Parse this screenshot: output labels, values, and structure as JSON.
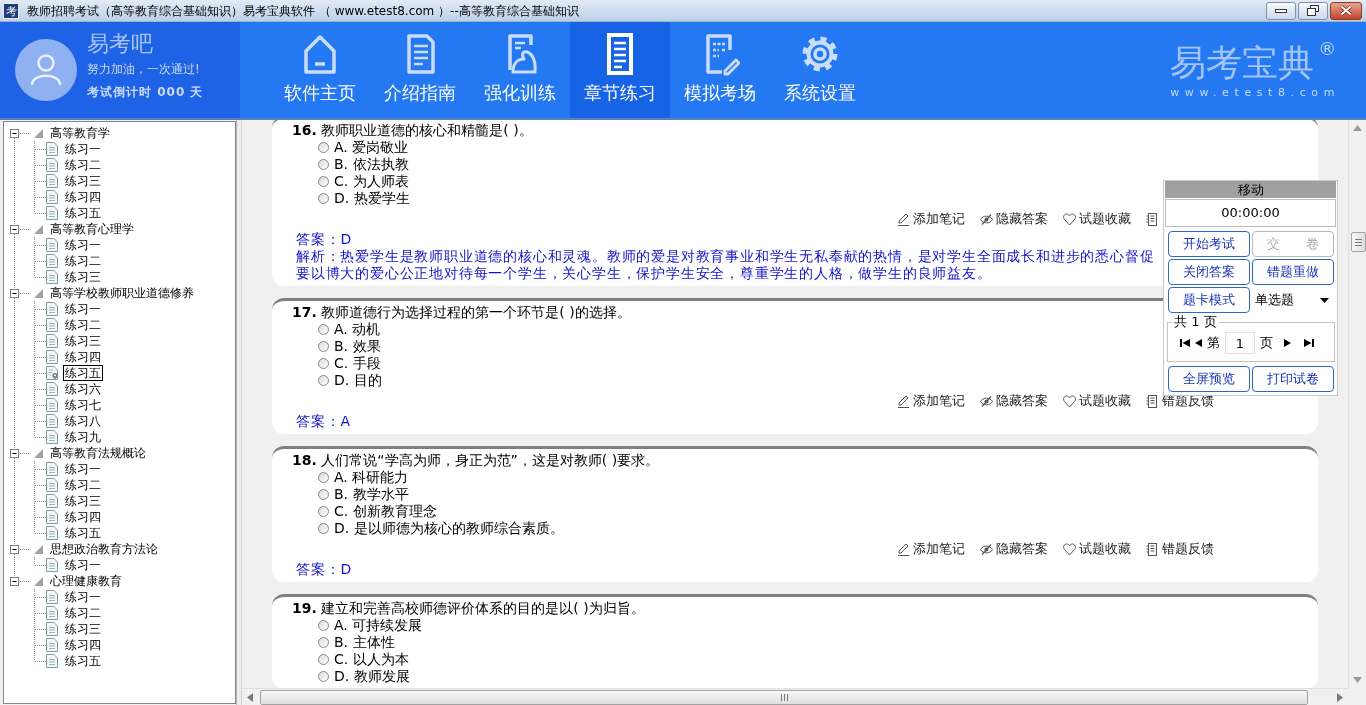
{
  "window": {
    "icon_text": "考",
    "title": "教师招聘考试（高等教育综合基础知识）易考宝典软件 （ www.etest8.com ）--高等教育综合基础知识"
  },
  "profile": {
    "name": "易考吧",
    "slogan": "努力加油，一次通过!",
    "countdown": "考试倒计时 000 天"
  },
  "nav": [
    {
      "label": "软件主页",
      "selected": false
    },
    {
      "label": "介绍指南",
      "selected": false
    },
    {
      "label": "强化训练",
      "selected": false
    },
    {
      "label": "章节练习",
      "selected": true
    },
    {
      "label": "模拟考场",
      "selected": false
    },
    {
      "label": "系统设置",
      "selected": false
    }
  ],
  "brand": {
    "name": "易考宝典$^{®}$",
    "url": "www.etest8.com"
  },
  "tree": [
    {
      "label": "高等教育学",
      "expanded": true,
      "selected": false,
      "children": [
        {
          "label": "练习一",
          "selected": false
        },
        {
          "label": "练习二",
          "selected": false
        },
        {
          "label": "练习三",
          "selected": false
        },
        {
          "label": "练习四",
          "selected": false
        },
        {
          "label": "练习五",
          "selected": false
        }
      ]
    },
    {
      "label": "高等教育心理学",
      "expanded": true,
      "selected": false,
      "children": [
        {
          "label": "练习一",
          "selected": false
        },
        {
          "label": "练习二",
          "selected": false
        },
        {
          "label": "练习三",
          "selected": false
        }
      ]
    },
    {
      "label": "高等学校教师职业道德修养",
      "expanded": true,
      "selected": false,
      "children": [
        {
          "label": "练习一",
          "selected": false
        },
        {
          "label": "练习二",
          "selected": false
        },
        {
          "label": "练习三",
          "selected": false
        },
        {
          "label": "练习四",
          "selected": false
        },
        {
          "label": "练习五",
          "selected": true
        },
        {
          "label": "练习六",
          "selected": false
        },
        {
          "label": "练习七",
          "selected": false
        },
        {
          "label": "练习八",
          "selected": false
        },
        {
          "label": "练习九",
          "selected": false
        }
      ]
    },
    {
      "label": "高等教育法规概论",
      "expanded": true,
      "selected": false,
      "children": [
        {
          "label": "练习一",
          "selected": false
        },
        {
          "label": "练习二",
          "selected": false
        },
        {
          "label": "练习三",
          "selected": false
        },
        {
          "label": "练习四",
          "selected": false
        },
        {
          "label": "练习五",
          "selected": false
        }
      ]
    },
    {
      "label": "思想政治教育方法论",
      "expanded": true,
      "selected": false,
      "children": [
        {
          "label": "练习一",
          "selected": false
        }
      ]
    },
    {
      "label": "心理健康教育",
      "expanded": true,
      "selected": false,
      "children": [
        {
          "label": "练习一",
          "selected": false
        },
        {
          "label": "练习二",
          "selected": false
        },
        {
          "label": "练习三",
          "selected": false
        },
        {
          "label": "练习四",
          "selected": false
        },
        {
          "label": "练习五",
          "selected": false
        }
      ]
    }
  ],
  "questions": [
    {
      "text": "**16.** 教师职业道德的核心和精髓是( )。",
      "options": [
        {
          "label": "A. 爱岗敬业",
          "selected": false
        },
        {
          "label": "B. 依法执教",
          "selected": false
        },
        {
          "label": "C. 为人师表",
          "selected": false
        },
        {
          "label": "D. 热爱学生",
          "selected": false
        }
      ],
      "actions": [
        "添加笔记",
        "隐藏答案",
        "试题收藏"
      ],
      "answer": "答案：D",
      "analysis": [
        "解析：热爱学生是教师职业道德的核心和灵魂。教师的爱是对教育事业和学生无私奉献的热情，是对学生全面成长和进步的悉心督促",
        "要以博大的爱心公正地对待每一个学生，关心学生，保护学生安全，尊重学生的人格，做学生的良师益友。"
      ]
    },
    {
      "text": "**17.** 教师道德行为选择过程的第一个环节是( )的选择。",
      "options": [
        {
          "label": "A. 动机",
          "selected": false
        },
        {
          "label": "B. 效果",
          "selected": false
        },
        {
          "label": "C. 手段",
          "selected": false
        },
        {
          "label": "D. 目的",
          "selected": false
        }
      ],
      "actions": [
        "添加笔记",
        "隐藏答案",
        "试题收藏",
        "错题反馈"
      ],
      "answer": "答案：A"
    },
    {
      "text": "**18.** 人们常说“学高为师，身正为范”，这是对教师( )要求。",
      "options": [
        {
          "label": "A. 科研能力",
          "selected": false
        },
        {
          "label": "B. 教学水平",
          "selected": false
        },
        {
          "label": "C. 创新教育理念",
          "selected": false
        },
        {
          "label": "D. 是以师德为核心的教师综合素质。",
          "selected": false
        }
      ],
      "actions": [
        "添加笔记",
        "隐藏答案",
        "试题收藏",
        "错题反馈"
      ],
      "answer": "答案：D"
    },
    {
      "text": "**19.** 建立和完善高校师德评价体系的目的是以( )为归旨。",
      "options": [
        {
          "label": "A. 可持续发展",
          "selected": false
        },
        {
          "label": "B. 主体性",
          "selected": false
        },
        {
          "label": "C. 以人为本",
          "selected": false
        },
        {
          "label": "D. 教师发展",
          "selected": false
        }
      ]
    }
  ],
  "panel": {
    "title": "移动",
    "timer": "00:00:00",
    "buttons": [
      {
        "label": "开始考试",
        "disabled": false
      },
      {
        "label": "交　　卷",
        "disabled": true
      },
      {
        "label": "关闭答案",
        "disabled": false
      },
      {
        "label": "错题重做",
        "disabled": false
      },
      {
        "label": "题卡模式",
        "disabled": false
      }
    ],
    "question_type": "单选题",
    "pager": {
      "total": "共 1 页",
      "prefix": "第",
      "page": "1",
      "suffix": "页"
    },
    "bottom_buttons": [
      {
        "label": "全屏预览",
        "disabled": false
      },
      {
        "label": "打印试卷",
        "disabled": false
      }
    ]
  }
}
